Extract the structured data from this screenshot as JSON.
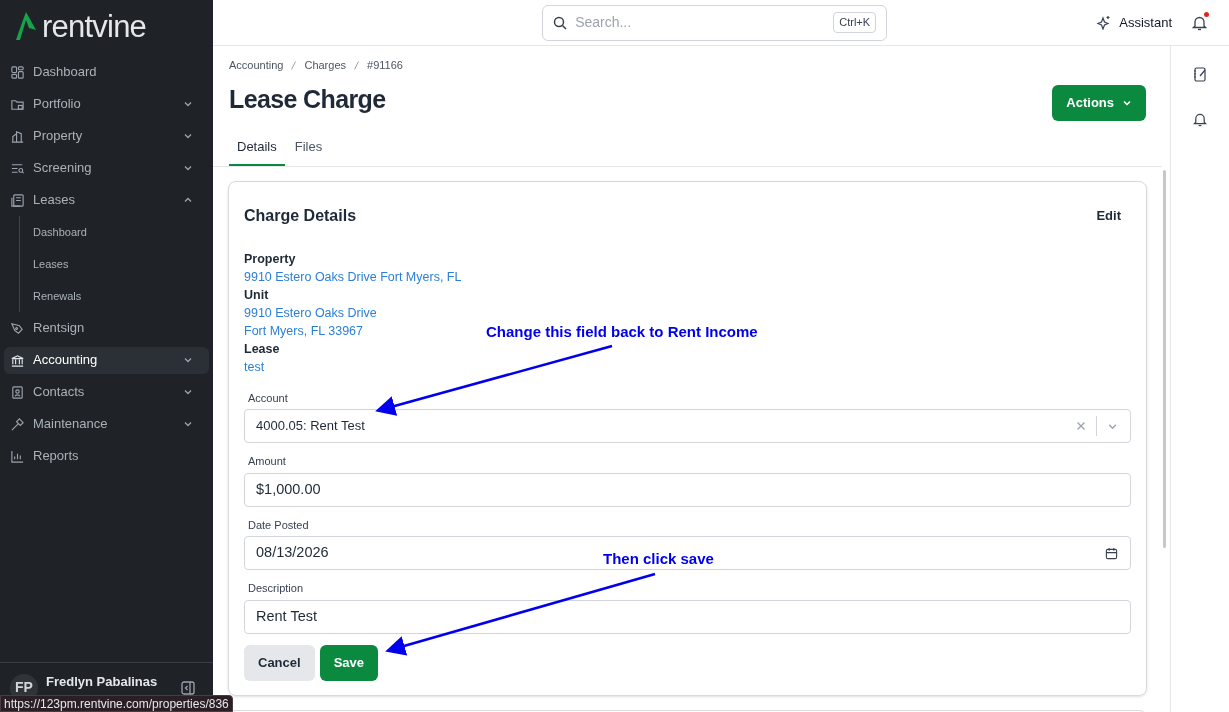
{
  "logo": {
    "text": "rentvine"
  },
  "sidebar": {
    "items": [
      {
        "label": "Dashboard",
        "selected": false
      },
      {
        "label": "Portfolio",
        "selected": false,
        "expanded": false
      },
      {
        "label": "Property",
        "selected": false,
        "expanded": false
      },
      {
        "label": "Screening",
        "selected": false,
        "expanded": false
      },
      {
        "label": "Leases",
        "selected": false,
        "expanded": true,
        "children": [
          {
            "label": "Dashboard"
          },
          {
            "label": "Leases"
          },
          {
            "label": "Renewals"
          }
        ]
      },
      {
        "label": "Rentsign",
        "selected": false
      },
      {
        "label": "Accounting",
        "selected": true,
        "expanded": false
      },
      {
        "label": "Contacts",
        "selected": false,
        "expanded": false
      },
      {
        "label": "Maintenance",
        "selected": false,
        "expanded": false
      },
      {
        "label": "Reports",
        "selected": false
      }
    ],
    "user": {
      "initials": "FP",
      "name": "Fredlyn Pabalinas"
    }
  },
  "status_url": "https://123pm.rentvine.com/properties/836",
  "topbar": {
    "search_placeholder": "Search...",
    "shortcut": "Ctrl+K",
    "assistant": "Assistant",
    "notification_dot": true
  },
  "breadcrumb": [
    "Accounting",
    "Charges",
    "#91166"
  ],
  "page_title": "Lease Charge",
  "actions_button": "Actions",
  "tabs": [
    {
      "label": "Details",
      "selected": true
    },
    {
      "label": "Files",
      "selected": false
    }
  ],
  "card": {
    "title": "Charge Details",
    "edit": "Edit",
    "info": [
      {
        "label": "Property",
        "lines": [
          "9910 Estero Oaks Drive Fort Myers, FL"
        ]
      },
      {
        "label": "Unit",
        "lines": [
          "9910 Estero Oaks Drive",
          "Fort Myers, FL 33967"
        ]
      },
      {
        "label": "Lease",
        "lines": [
          "test"
        ]
      }
    ],
    "fields": [
      {
        "kind": "select",
        "label": "Account",
        "value": "4000.05: Rent Test"
      },
      {
        "kind": "text",
        "label": "Amount",
        "value": "$1,000.00"
      },
      {
        "kind": "date",
        "label": "Date Posted",
        "value": "08/13/2026"
      },
      {
        "kind": "text",
        "label": "Description",
        "value": "Rent Test"
      }
    ],
    "buttons": [
      "Cancel",
      "Save"
    ]
  },
  "annotations": [
    "Change this field back to Rent Income",
    "Then click save"
  ]
}
